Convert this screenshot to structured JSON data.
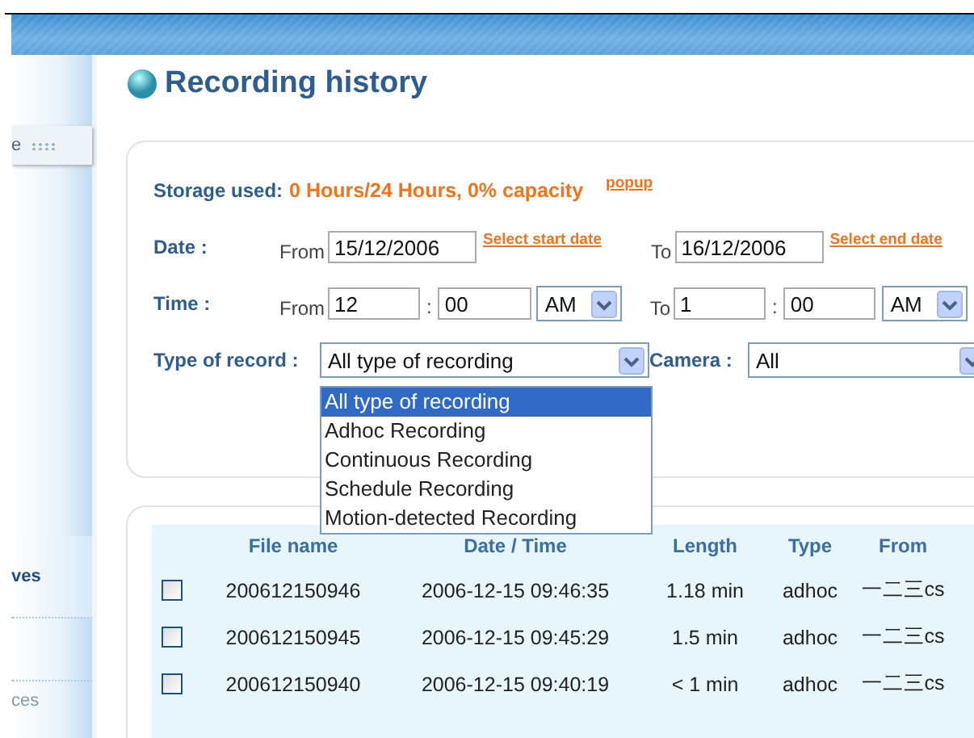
{
  "sidebar": {
    "items": [
      {
        "label": "e",
        "kind": "grip"
      },
      {
        "label": "ves",
        "kind": "active"
      },
      {
        "label": "ces",
        "kind": "plain"
      }
    ]
  },
  "page_title": "Recording history",
  "storage": {
    "label": "Storage used:",
    "value": "0 Hours/24 Hours, 0% capacity",
    "link": "popup"
  },
  "date": {
    "label": "Date :",
    "from_label": "From",
    "from_value": "15/12/2006",
    "from_link": "Select start date",
    "to_label": "To",
    "to_value": "16/12/2006",
    "to_link": "Select end date"
  },
  "time": {
    "label": "Time :",
    "from_label": "From",
    "from_hour": "12",
    "from_minute": "00",
    "from_ampm": "AM",
    "to_label": "To",
    "to_hour": "1",
    "to_minute": "00",
    "to_ampm": "AM",
    "separator": ":"
  },
  "type_of_record": {
    "label": "Type of record :",
    "value": "All type of recording",
    "expanded": true,
    "options": [
      {
        "label": "All type of recording",
        "selected": true
      },
      {
        "label": "Adhoc Recording",
        "selected": false
      },
      {
        "label": "Continuous Recording",
        "selected": false
      },
      {
        "label": "Schedule Recording",
        "selected": false
      },
      {
        "label": "Motion-detected Recording",
        "selected": false
      }
    ]
  },
  "camera": {
    "label": "Camera :",
    "value": "All"
  },
  "table": {
    "columns": [
      "File name",
      "Date / Time",
      "Length",
      "Type",
      "From"
    ],
    "rows": [
      {
        "checked": false,
        "cells": [
          "200612150946",
          "2006-12-15 09:46:35",
          "1.18 min",
          "adhoc",
          "一二三cs"
        ]
      },
      {
        "checked": false,
        "cells": [
          "200612150945",
          "2006-12-15 09:45:29",
          "1.5 min",
          "adhoc",
          "一二三cs"
        ]
      },
      {
        "checked": false,
        "cells": [
          "200612150940",
          "2006-12-15 09:40:19",
          "< 1 min",
          "adhoc",
          "一二三cs"
        ]
      }
    ]
  }
}
